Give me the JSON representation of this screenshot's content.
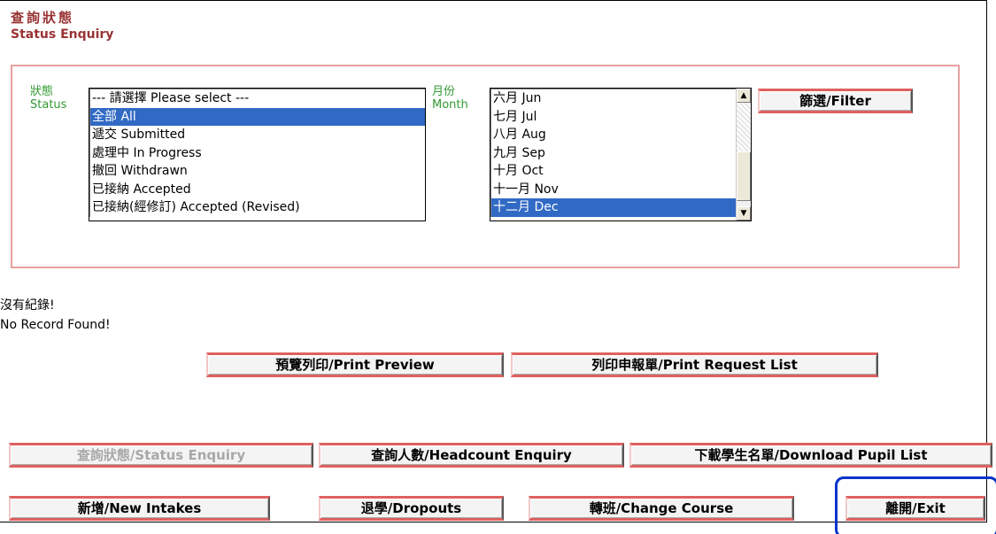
{
  "header": {
    "title_zh": "查詢狀態",
    "title_en": "Status Enquiry"
  },
  "filter": {
    "status_label_zh": "狀態",
    "status_label_en": "Status",
    "status_options": [
      "--- 請選擇 Please select ---",
      "全部 All",
      "遞交 Submitted",
      "處理中 In Progress",
      "撤回 Withdrawn",
      "已接納 Accepted",
      "已接納(經修訂) Accepted (Revised)"
    ],
    "status_selected": "全部 All",
    "month_label_zh": "月份",
    "month_label_en": "Month",
    "month_options": [
      "六月 Jun",
      "七月 Jul",
      "八月 Aug",
      "九月 Sep",
      "十月 Oct",
      "十一月 Nov",
      "十二月 Dec"
    ],
    "month_selected": "十二月 Dec",
    "filter_button": "篩選/Filter"
  },
  "results": {
    "no_record_zh": "沒有紀錄!",
    "no_record_en": "No Record Found!",
    "print_preview_button": "預覽列印/Print Preview",
    "print_request_list_button": "列印申報單/Print Request List"
  },
  "nav": {
    "status_enquiry": "查詢狀態/Status Enquiry",
    "headcount_enquiry": "查詢人數/Headcount Enquiry",
    "download_pupil_list": "下載學生名單/Download Pupil List",
    "new_intakes": "新增/New Intakes",
    "dropouts": "退學/Dropouts",
    "change_course": "轉班/Change Course",
    "exit": "離開/Exit"
  },
  "colors": {
    "title": "#993333",
    "field_label": "#339933",
    "filter_border": "#e8a0a0",
    "button_accent": "#e06060",
    "selection": "#316ac5",
    "focus_ring": "#0033cc"
  }
}
